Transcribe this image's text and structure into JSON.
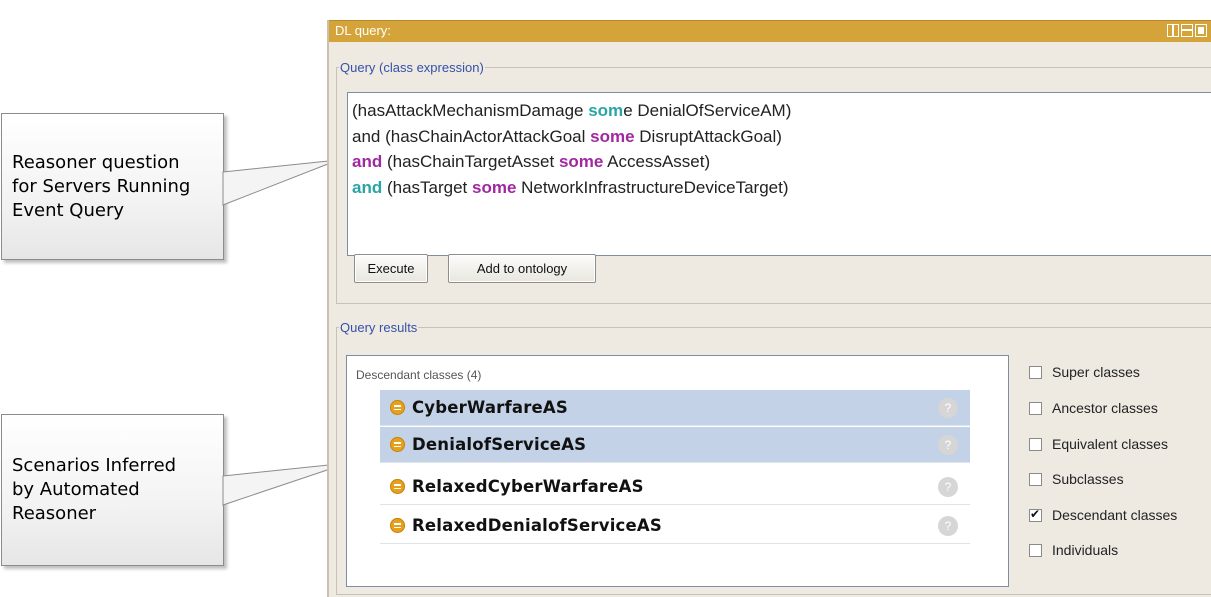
{
  "callouts": {
    "query_note": "Reasoner question\nfor Servers Running\nEvent Query",
    "scenarios_note": "Scenarios Inferred\nby Automated\nReasoner"
  },
  "panel": {
    "title": "DL query:",
    "header_icons": [
      "split-vertical-icon",
      "split-horizontal-icon",
      "maximize-icon"
    ],
    "colors": {
      "header": "#d4a43a",
      "background": "#eeeae2",
      "keyword_teal": "#2aa5a5",
      "keyword_purple": "#a028a0"
    }
  },
  "query": {
    "legend": "Query (class expression)",
    "lines": [
      {
        "a": "(hasAttackMechanismDamage ",
        "b": "som",
        "c": "e DenialOfServiceAM)"
      },
      {
        "a": "and (hasChainActorAttackGoal ",
        "b": "some",
        "c": " DisruptAttackGoal)"
      },
      {
        "a": "and",
        "b": " (hasChainTargetAsset ",
        "c": "some",
        "d": " AccessAsset)"
      },
      {
        "a": "and",
        "b": " (hasTarget ",
        "c": "some",
        "d": " NetworkInfrastructureDeviceTarget)"
      }
    ],
    "execute_label": "Execute",
    "add_label": "Add to ontology"
  },
  "results": {
    "legend": "Query results",
    "caption": "Descendant classes (4)",
    "items": [
      {
        "label": "CyberWarfareAS",
        "help": "?"
      },
      {
        "label": "DenialofServiceAS",
        "help": "?"
      },
      {
        "label": "RelaxedCyberWarfareAS",
        "help": "?"
      },
      {
        "label": "RelaxedDenialofServiceAS",
        "help": "?"
      }
    ],
    "options": [
      {
        "label": "Super classes",
        "checked": false
      },
      {
        "label": "Ancestor classes",
        "checked": false
      },
      {
        "label": "Equivalent classes",
        "checked": false
      },
      {
        "label": "Subclasses",
        "checked": false
      },
      {
        "label": "Descendant classes",
        "checked": true
      },
      {
        "label": "Individuals",
        "checked": false
      }
    ]
  }
}
